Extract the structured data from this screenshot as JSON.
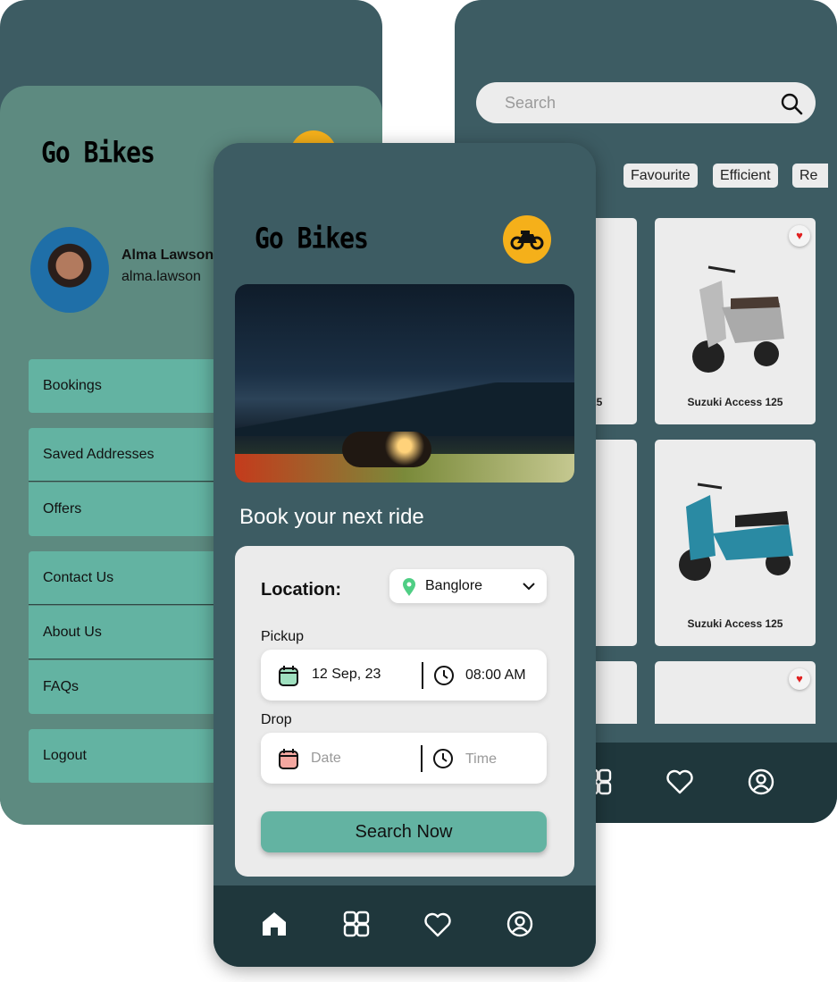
{
  "brand": "Go Bikes",
  "profile": {
    "name": "Alma Lawson",
    "email": "alma.lawson"
  },
  "menu": [
    "Bookings",
    "Saved Addresses",
    "Offers",
    "Contact Us",
    "About Us",
    "FAQs",
    "Logout"
  ],
  "browse": {
    "search_placeholder": "Search",
    "chips": [
      "Favourite",
      "Efficient",
      "Re"
    ],
    "cards": [
      {
        "name": "25"
      },
      {
        "name": "Suzuki Access 125",
        "favourite": true
      },
      {
        "name": "Suzuki Access 125",
        "favourite": false
      },
      {
        "name": "",
        "favourite": true
      }
    ]
  },
  "home": {
    "heading": "Book your next ride",
    "location_label": "Location:",
    "location_value": "Banglore",
    "pickup_label": "Pickup",
    "pickup_date": "12 Sep, 23",
    "pickup_time": "08:00 AM",
    "drop_label": "Drop",
    "drop_date_placeholder": "Date",
    "drop_time_placeholder": "Time",
    "search_button": "Search Now"
  },
  "colors": {
    "accent": "#63b3a2",
    "panel": "#3d5c63",
    "nav": "#1f373c",
    "logo_badge": "#f5b01a",
    "heart": "#e02020"
  }
}
